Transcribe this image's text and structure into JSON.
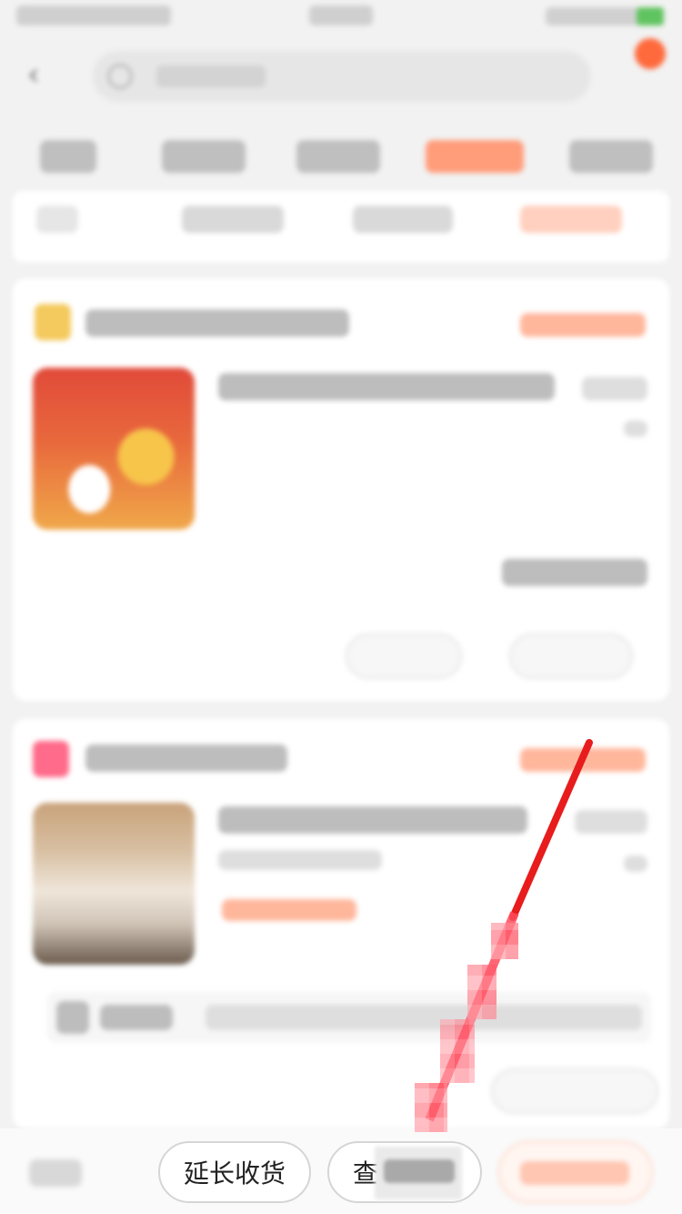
{
  "screen": {
    "background": "#f2f2f2",
    "accent": "#ff6a3d"
  },
  "bottom_actions": {
    "extend_receipt_label": "延长收货",
    "view_prefix_label": "查"
  },
  "icons": [
    "back-arrow-icon",
    "search-icon",
    "notification-badge-icon",
    "shop-icon",
    "red-arrow-annotation"
  ]
}
